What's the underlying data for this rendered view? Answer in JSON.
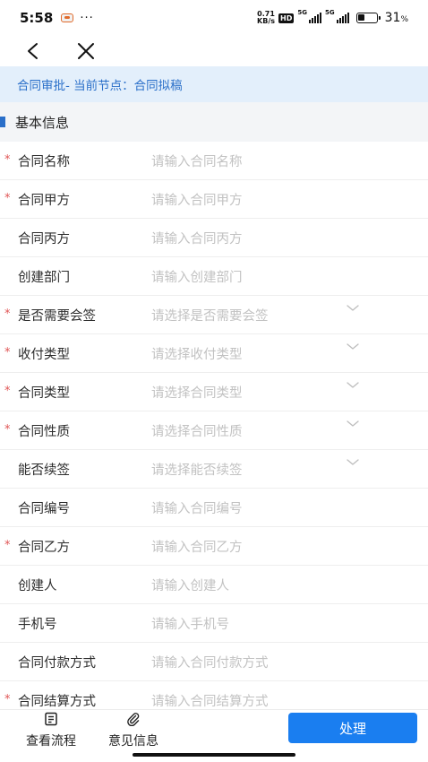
{
  "status_bar": {
    "time": "5:58",
    "dots": "···",
    "speed_value": "0.71",
    "speed_unit": "KB/s",
    "hd_badge": "HD",
    "net_1": "5G",
    "net_2": "5G",
    "battery_pct": "31",
    "battery_unit": "%"
  },
  "nav": {
    "back_icon": "chevron-left-icon",
    "close_icon": "close-icon"
  },
  "banner": {
    "text": "合同审批- 当前节点：合同拟稿"
  },
  "section": {
    "title": "基本信息"
  },
  "form": {
    "fields": [
      {
        "label": "合同名称",
        "placeholder": "请输入合同名称",
        "required": true,
        "type": "input"
      },
      {
        "label": "合同甲方",
        "placeholder": "请输入合同甲方",
        "required": true,
        "type": "input"
      },
      {
        "label": "合同丙方",
        "placeholder": "请输入合同丙方",
        "required": false,
        "type": "input"
      },
      {
        "label": "创建部门",
        "placeholder": "请输入创建部门",
        "required": false,
        "type": "input"
      },
      {
        "label": "是否需要会签",
        "placeholder": "请选择是否需要会签",
        "required": true,
        "type": "select"
      },
      {
        "label": "收付类型",
        "placeholder": "请选择收付类型",
        "required": true,
        "type": "select"
      },
      {
        "label": "合同类型",
        "placeholder": "请选择合同类型",
        "required": true,
        "type": "select"
      },
      {
        "label": "合同性质",
        "placeholder": "请选择合同性质",
        "required": true,
        "type": "select"
      },
      {
        "label": "能否续签",
        "placeholder": "请选择能否续签",
        "required": false,
        "type": "select"
      },
      {
        "label": "合同编号",
        "placeholder": "请输入合同编号",
        "required": false,
        "type": "input"
      },
      {
        "label": "合同乙方",
        "placeholder": "请输入合同乙方",
        "required": true,
        "type": "input"
      },
      {
        "label": "创建人",
        "placeholder": "请输入创建人",
        "required": false,
        "type": "input"
      },
      {
        "label": "手机号",
        "placeholder": "请输入手机号",
        "required": false,
        "type": "input"
      },
      {
        "label": "合同付款方式",
        "placeholder": "请输入合同付款方式",
        "required": false,
        "type": "input"
      },
      {
        "label": "合同结算方式",
        "placeholder": "请输入合同结算方式",
        "required": true,
        "type": "input"
      }
    ],
    "required_mark": "*"
  },
  "bottom_bar": {
    "view_flow": "查看流程",
    "view_flow_icon": "document-icon",
    "opinion": "意见信息",
    "opinion_icon": "paperclip-icon",
    "handle": "处理"
  },
  "colors": {
    "accent": "#1a7ef0",
    "banner_bg": "#e3effb",
    "banner_text": "#2a6fc9",
    "required": "#e05555",
    "placeholder": "#c2c2c2"
  }
}
